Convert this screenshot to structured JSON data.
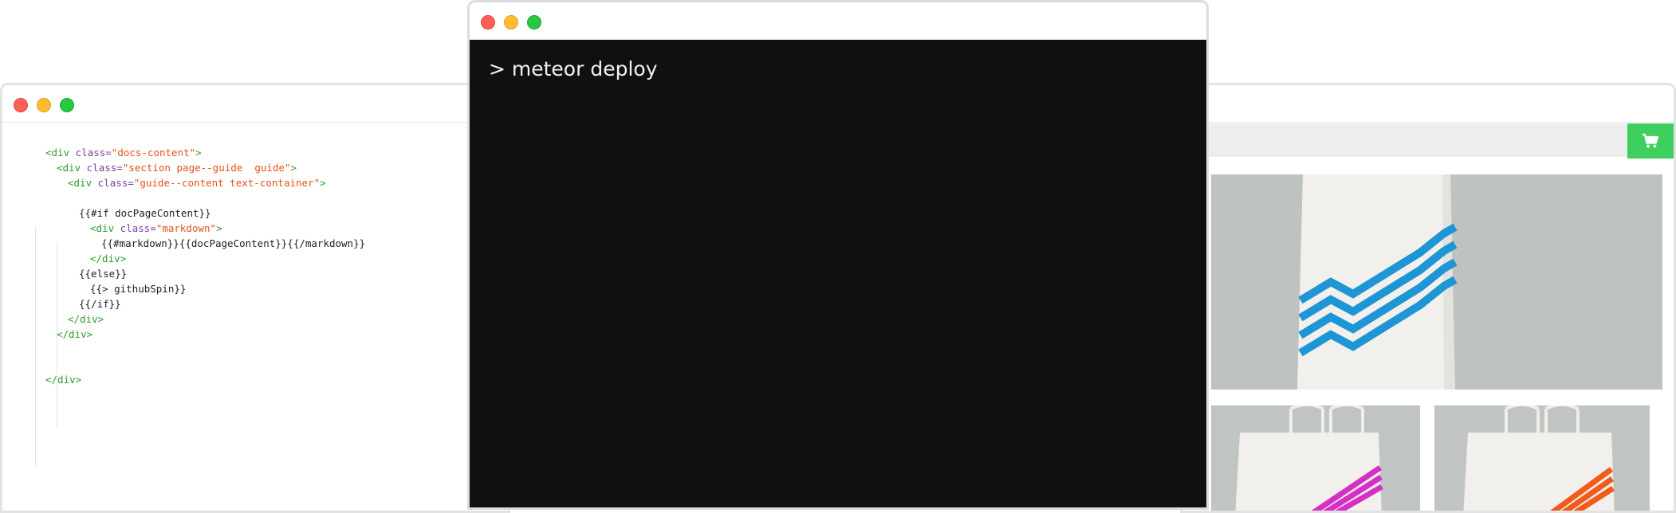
{
  "editor": {
    "lines": [
      {
        "indent": 0,
        "parts": [
          {
            "t": "tg",
            "v": "<div "
          },
          {
            "t": "at",
            "v": "class="
          },
          {
            "t": "st",
            "v": "\"docs-content\""
          },
          {
            "t": "tg",
            "v": ">"
          }
        ]
      },
      {
        "indent": 1,
        "parts": [
          {
            "t": "tg",
            "v": "<div "
          },
          {
            "t": "at",
            "v": "class="
          },
          {
            "t": "st",
            "v": "\"section page--guide  guide\""
          },
          {
            "t": "tg",
            "v": ">"
          }
        ]
      },
      {
        "indent": 2,
        "parts": [
          {
            "t": "tg",
            "v": "<div "
          },
          {
            "t": "at",
            "v": "class="
          },
          {
            "t": "st",
            "v": "\"guide--content text-container\""
          },
          {
            "t": "tg",
            "v": ">"
          }
        ]
      },
      {
        "indent": 0,
        "parts": []
      },
      {
        "indent": 3,
        "parts": [
          {
            "t": "",
            "v": "{{#if docPageContent}}"
          }
        ]
      },
      {
        "indent": 4,
        "parts": [
          {
            "t": "tg",
            "v": "<div "
          },
          {
            "t": "at",
            "v": "class="
          },
          {
            "t": "st",
            "v": "\"markdown\""
          },
          {
            "t": "tg",
            "v": ">"
          }
        ]
      },
      {
        "indent": 5,
        "parts": [
          {
            "t": "",
            "v": "{{#markdown}}{{docPageContent}}{{/markdown}}"
          }
        ]
      },
      {
        "indent": 4,
        "parts": [
          {
            "t": "tg",
            "v": "</div>"
          }
        ]
      },
      {
        "indent": 3,
        "parts": [
          {
            "t": "",
            "v": "{{else}}"
          }
        ]
      },
      {
        "indent": 4,
        "parts": [
          {
            "t": "",
            "v": "{{> githubSpin}}"
          }
        ]
      },
      {
        "indent": 3,
        "parts": [
          {
            "t": "",
            "v": "{{/if}}"
          }
        ]
      },
      {
        "indent": 2,
        "parts": [
          {
            "t": "tg",
            "v": "</div>"
          }
        ]
      },
      {
        "indent": 1,
        "parts": [
          {
            "t": "tg",
            "v": "</div>"
          }
        ]
      },
      {
        "indent": 0,
        "parts": []
      },
      {
        "indent": 0,
        "parts": []
      },
      {
        "indent": 0,
        "parts": [
          {
            "t": "tg",
            "v": "</div>"
          }
        ]
      }
    ]
  },
  "terminal": {
    "command": "> meteor deploy"
  },
  "shop": {
    "cart_icon": "shopping-cart-icon",
    "accent_color": "#3ecf5e",
    "products": [
      {
        "stripe_color": "#1e95d4"
      },
      {
        "stripe_color": "#d62fc6"
      },
      {
        "stripe_color": "#f25b1c"
      }
    ]
  },
  "colors": {
    "tag": "#2e9b2e",
    "attribute": "#7a3fa0",
    "string": "#e0531b",
    "terminal_bg": "#101010"
  }
}
